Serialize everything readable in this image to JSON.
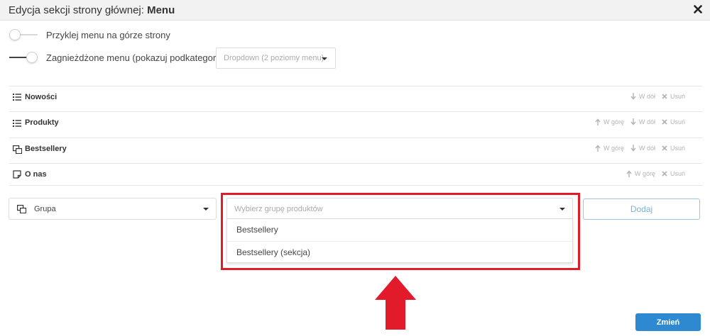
{
  "modal": {
    "title_prefix": "Edycja sekcji strony głównej:",
    "title_bold": "Menu",
    "close_glyph": "✖"
  },
  "toggles": [
    {
      "label": "Przyklej menu na górze strony",
      "on": false
    },
    {
      "label": "Zagnieżdżone menu (pokazuj podkategorie)",
      "on": true
    }
  ],
  "dropdown_mode": {
    "value": "Dropdown (2 poziomy menu)"
  },
  "menu_items": [
    {
      "name": "Nowości",
      "icon": "list-icon",
      "up_label": "",
      "down_label": "W dół",
      "delete_label": "Usuń"
    },
    {
      "name": "Produkty",
      "icon": "list-icon",
      "up_label": "W górę",
      "down_label": "W dół",
      "delete_label": "Usuń"
    },
    {
      "name": "Bestsellery",
      "icon": "product-group-icon",
      "up_label": "W górę",
      "down_label": "W dół",
      "delete_label": "Usuń"
    },
    {
      "name": "O nas",
      "icon": "page-icon",
      "up_label": "W górę",
      "down_label": "",
      "delete_label": "Usuń"
    }
  ],
  "add_form": {
    "type_select": {
      "value": "Grupa",
      "icon": "product-group-icon"
    },
    "group_select": {
      "placeholder": "Wybierz grupę produktów",
      "options": [
        "Bestsellery",
        "Bestsellery (sekcja)"
      ]
    },
    "add_label": "Dodaj"
  },
  "footer": {
    "submit_label": "Zmień"
  },
  "colors": {
    "accent": "#2e89d0",
    "highlight": "#e21b2a",
    "add_button": "#7bb3dc"
  }
}
